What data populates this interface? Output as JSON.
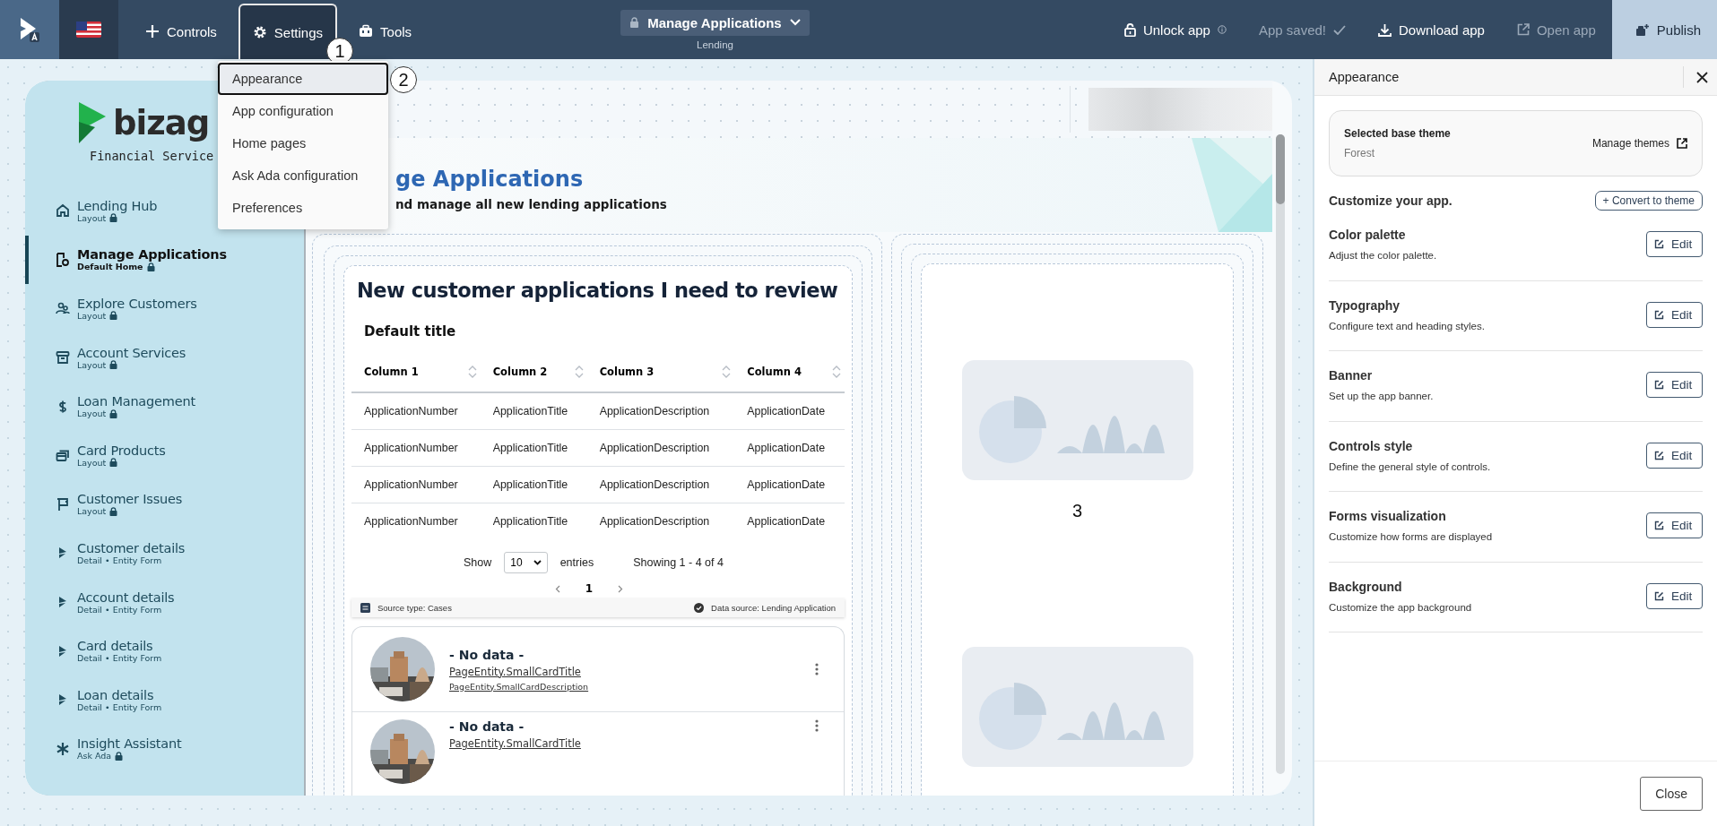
{
  "nav": [
    {
      "label": "Controls",
      "selected": false
    },
    {
      "label": "Settings",
      "selected": true,
      "step_badge": "1"
    },
    {
      "label": "Tools",
      "selected": false
    }
  ],
  "page_selector": {
    "label": "Manage Applications",
    "subtitle": "Lending"
  },
  "actions": [
    {
      "label": "Unlock app",
      "disabled": false,
      "highlighted": false
    },
    {
      "label": "App saved!",
      "disabled": true,
      "highlighted": false
    },
    {
      "label": "Download app",
      "disabled": false,
      "highlighted": false
    },
    {
      "label": "Open app",
      "disabled": true,
      "highlighted": false
    },
    {
      "label": "Publish",
      "disabled": false,
      "highlighted": true
    }
  ],
  "settings_menu": [
    {
      "label": "Appearance",
      "selected": true,
      "step_badge": "2"
    },
    {
      "label": "App configuration",
      "selected": false
    },
    {
      "label": "Home pages",
      "selected": false
    },
    {
      "label": "Ask Ada configuration",
      "selected": false
    },
    {
      "label": "Preferences",
      "selected": false
    }
  ],
  "app_preview": {
    "logo": {
      "name": "bizag",
      "tagline": "Financial Service"
    },
    "sidebar": [
      {
        "name": "Lending Hub",
        "sub": "Layout",
        "locked": true,
        "selected": false
      },
      {
        "name": "Manage Applications",
        "sub": "Default Home",
        "locked": true,
        "selected": true
      },
      {
        "name": "Explore Customers",
        "sub": "Layout",
        "locked": true,
        "selected": false
      },
      {
        "name": "Account Services",
        "sub": "Layout",
        "locked": true,
        "selected": false
      },
      {
        "name": "Loan Management",
        "sub": "Layout",
        "locked": true,
        "selected": false
      },
      {
        "name": "Card Products",
        "sub": "Layout",
        "locked": true,
        "selected": false
      },
      {
        "name": "Customer Issues",
        "sub": "Layout",
        "locked": true,
        "selected": false
      },
      {
        "name": "Customer details",
        "sub": "Detail • Entity Form",
        "locked": false,
        "selected": false
      },
      {
        "name": "Account details",
        "sub": "Detail • Entity Form",
        "locked": false,
        "selected": false
      },
      {
        "name": "Card details",
        "sub": "Detail • Entity Form",
        "locked": false,
        "selected": false
      },
      {
        "name": "Loan details",
        "sub": "Detail • Entity Form",
        "locked": false,
        "selected": false
      },
      {
        "name": "Insight Assistant",
        "sub": "Ask Ada",
        "locked": true,
        "selected": false
      }
    ],
    "banner": {
      "title": "ge Applications",
      "subtitle": "nd manage all new lending applications"
    },
    "widget": {
      "title": "New customer applications I need to review",
      "table": {
        "title": "Default title",
        "columns": [
          "Column 1",
          "Column 2",
          "Column 3",
          "Column 4"
        ],
        "rows": [
          [
            "ApplicationNumber",
            "ApplicationTitle",
            "ApplicationDescription",
            "ApplicationDate"
          ],
          [
            "ApplicationNumber",
            "ApplicationTitle",
            "ApplicationDescription",
            "ApplicationDate"
          ],
          [
            "ApplicationNumber",
            "ApplicationTitle",
            "ApplicationDescription",
            "ApplicationDate"
          ],
          [
            "ApplicationNumber",
            "ApplicationTitle",
            "ApplicationDescription",
            "ApplicationDate"
          ]
        ]
      },
      "pager": {
        "show_label": "Show",
        "page_size": "10",
        "entries_label": "entries",
        "summary": "Showing 1 - 4 of 4",
        "page": "1"
      },
      "source": {
        "type_label": "Source type:",
        "type": "Cases",
        "data_label": "Data source:",
        "data": "Lending Application"
      },
      "cards": [
        {
          "title": "- No data -",
          "link": "PageEntity.SmallCardTitle",
          "description": "PageEntity.SmallCardDescription"
        },
        {
          "title": "- No data -",
          "link": "PageEntity.SmallCardTitle"
        }
      ]
    },
    "placeholder_label": "3"
  },
  "panel": {
    "title": "Appearance",
    "theme": {
      "label": "Selected base theme",
      "value": "Forest",
      "manage": "Manage themes"
    },
    "customize_label": "Customize your app.",
    "convert_button": "+ Convert to theme",
    "sections": [
      {
        "title": "Color palette",
        "description": "Adjust the color palette.",
        "button": "Edit"
      },
      {
        "title": "Typography",
        "description": "Configure text and heading styles.",
        "button": "Edit"
      },
      {
        "title": "Banner",
        "description": "Set up the app banner.",
        "button": "Edit"
      },
      {
        "title": "Controls style",
        "description": "Define the general style of controls.",
        "button": "Edit"
      },
      {
        "title": "Forms visualization",
        "description": "Customize how forms are displayed",
        "button": "Edit"
      },
      {
        "title": "Background",
        "description": "Customize the app background",
        "button": "Edit"
      }
    ],
    "close_button": "Close"
  }
}
